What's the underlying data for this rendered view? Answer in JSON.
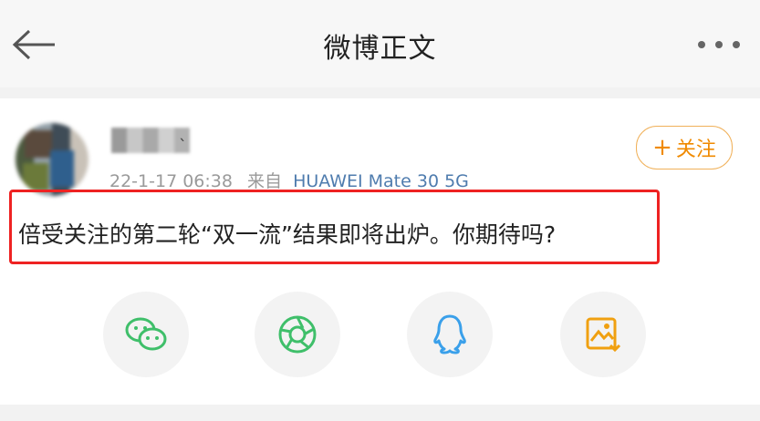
{
  "header": {
    "title": "微博正文"
  },
  "post": {
    "meta_time": "22-1-17 06:38",
    "meta_from": "来自",
    "meta_device": "HUAWEI Mate 30 5G",
    "follow_label": "关注",
    "follow_plus": "+",
    "text": "倍受关注的第二轮“双一流”结果即将出炉。你期待吗?"
  },
  "share_icons": [
    "wechat-icon",
    "moments-icon",
    "qq-icon",
    "save-image-icon"
  ],
  "colors": {
    "accent": "#f08a00",
    "device_link": "#4f7cae",
    "highlight_border": "#ee2222",
    "wechat": "#3fbf6a",
    "qq": "#3aa0ea",
    "save": "#f0a010"
  }
}
